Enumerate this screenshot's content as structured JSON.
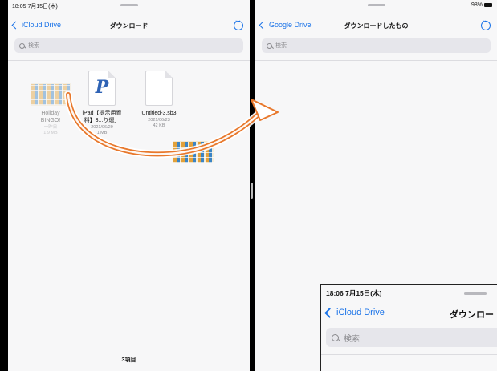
{
  "left": {
    "time": "18:05  7月15日(木)",
    "back_label": "iCloud Drive",
    "title": "ダウンロード",
    "search_placeholder": "検索",
    "files": [
      {
        "name_line1": "Holiday",
        "name_line2": "BINGO!",
        "meta1": "一昨日",
        "meta2": "1.9 MB"
      },
      {
        "name_line1": "iPad【提示用資",
        "name_line2": "料】3...り運」",
        "meta1": "2021/06/29",
        "meta2": "1 MB"
      },
      {
        "name_line1": "Untitled-3.sb3",
        "name_line2": "",
        "meta1": "2021/06/23",
        "meta2": "42 KB"
      }
    ],
    "footer": "3項目"
  },
  "right": {
    "battery": "98%",
    "back_label": "Google Drive",
    "title": "ダウンロードしたもの",
    "search_placeholder": "検索"
  },
  "inset": {
    "time": "18:06  7月15日(木)",
    "back_label": "iCloud Drive",
    "title": "ダウンロー",
    "search_placeholder": "検索"
  },
  "colors": {
    "accent": "#1a73e8",
    "arrow": "#e8782c"
  }
}
